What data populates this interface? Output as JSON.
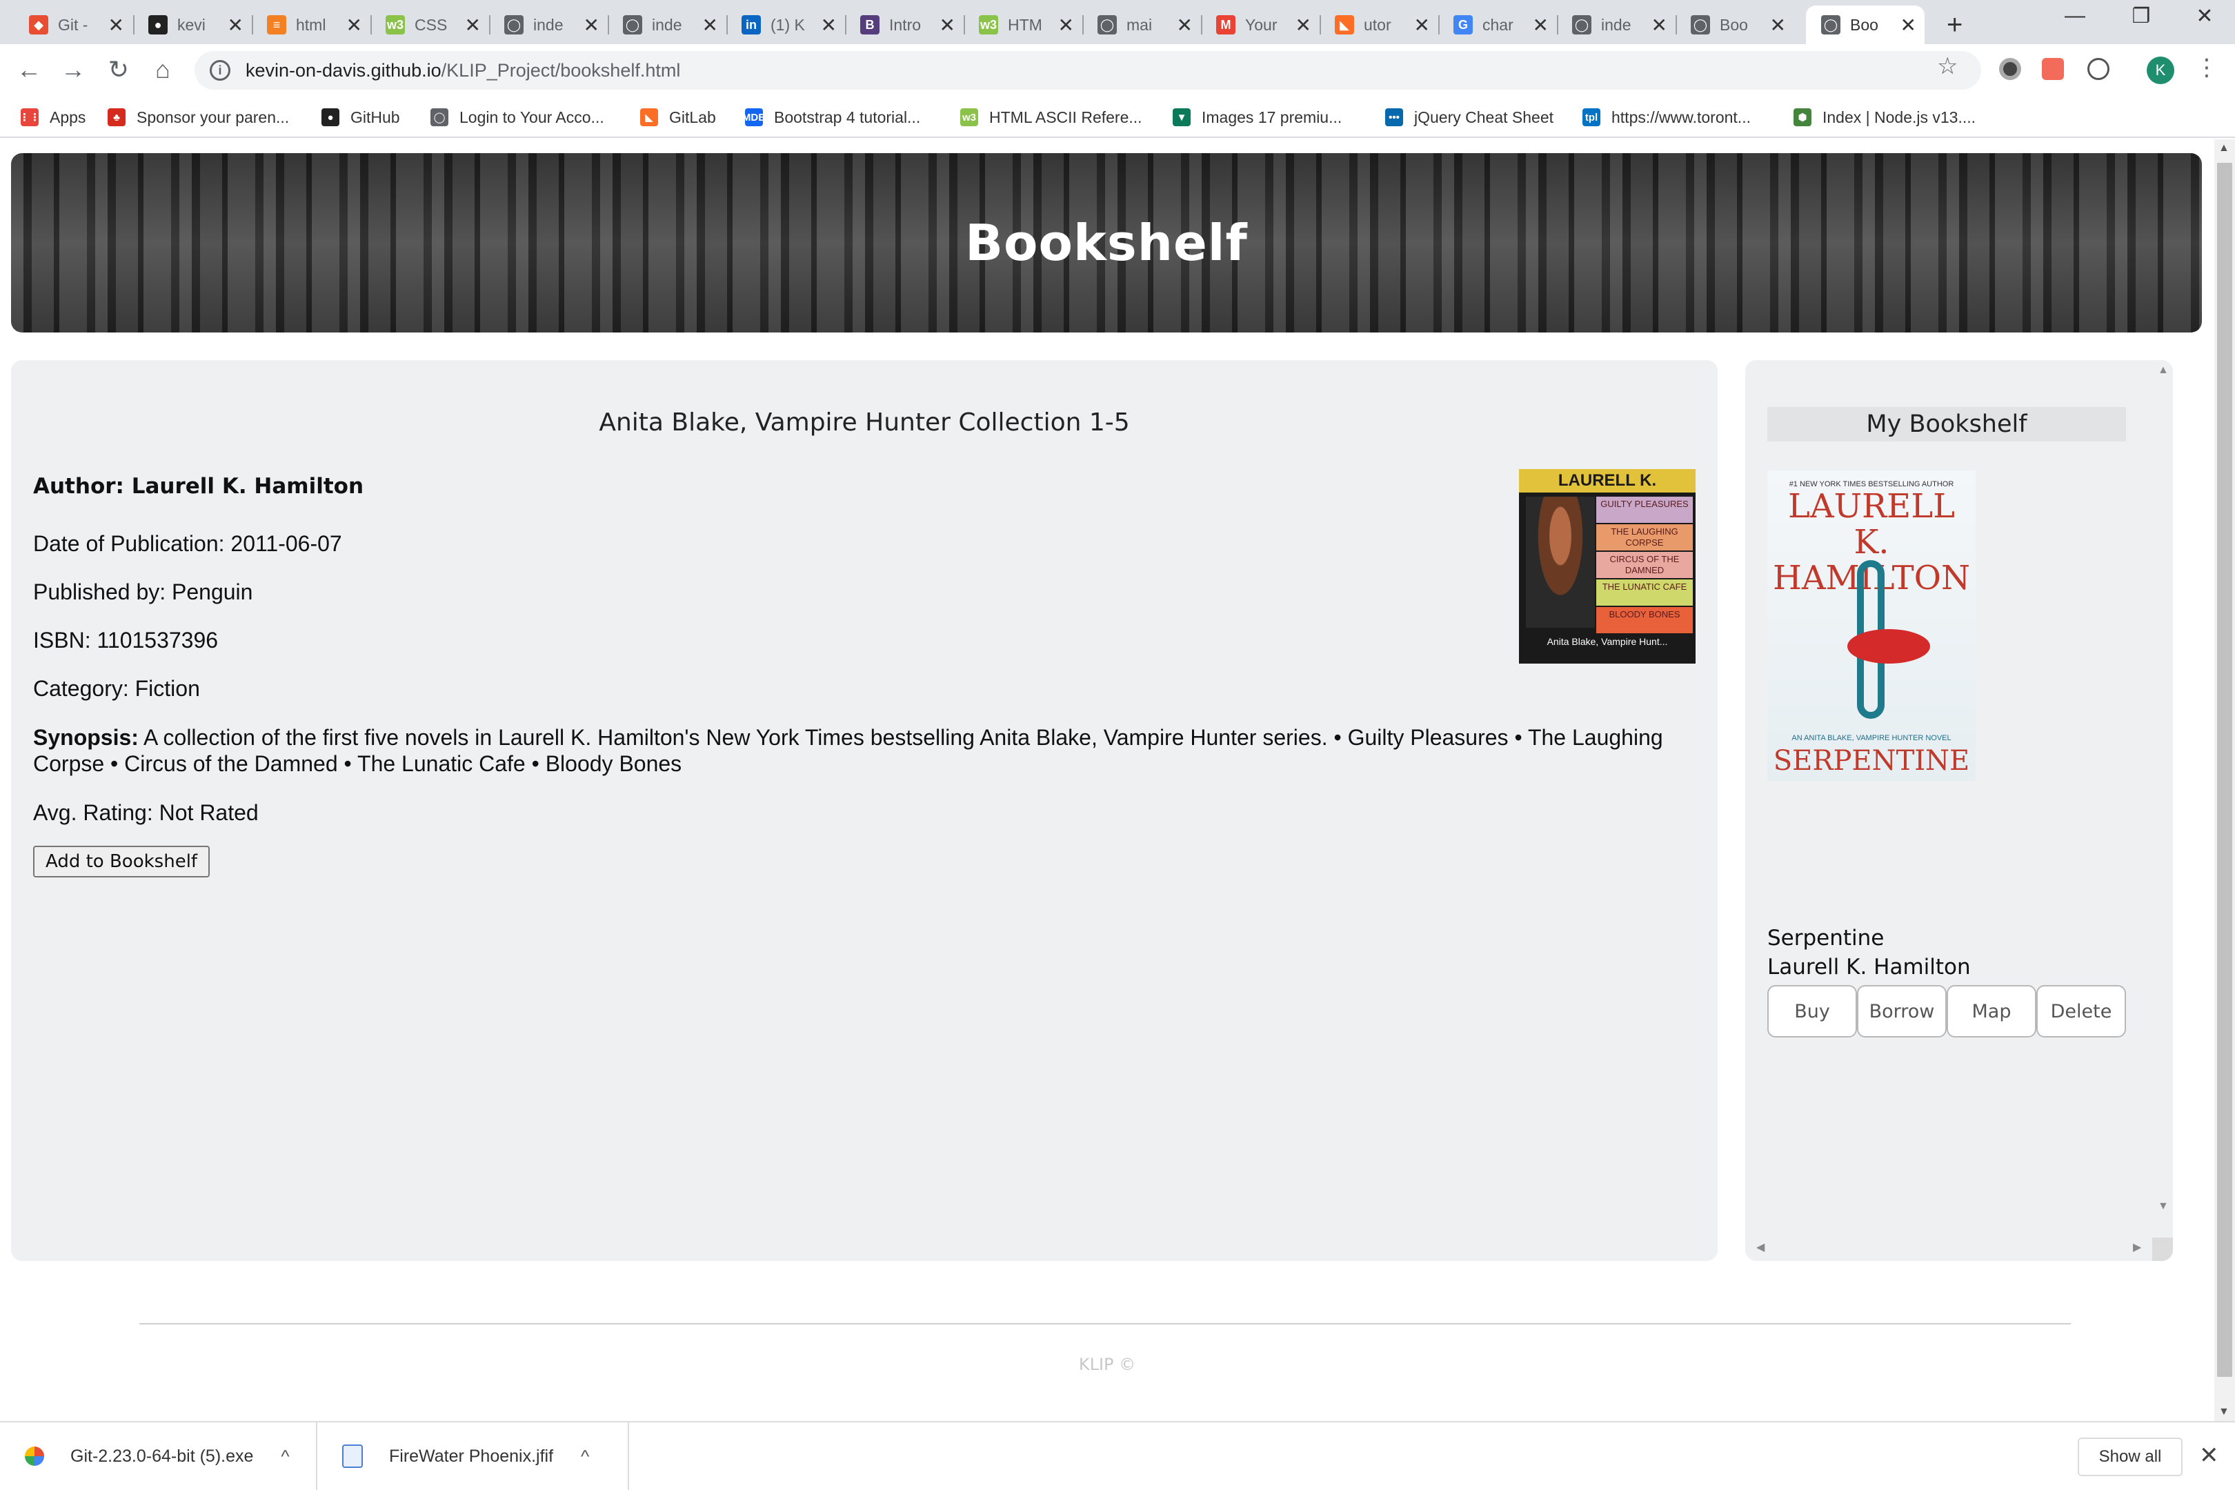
{
  "browser": {
    "tabs": [
      {
        "label": "Git -",
        "fav_color": "#e84e31",
        "fav_glyph": "◆"
      },
      {
        "label": "kevi",
        "fav_color": "#222222",
        "fav_glyph": "●"
      },
      {
        "label": "html",
        "fav_color": "#f48024",
        "fav_glyph": "≡"
      },
      {
        "label": "CSS",
        "fav_color": "#8bc34a",
        "fav_glyph": "w3"
      },
      {
        "label": "inde",
        "fav_color": "#5f6368",
        "fav_glyph": "◯"
      },
      {
        "label": "inde",
        "fav_color": "#5f6368",
        "fav_glyph": "◯"
      },
      {
        "label": "(1) K",
        "fav_color": "#0a66c2",
        "fav_glyph": "in"
      },
      {
        "label": "Intro",
        "fav_color": "#563d7c",
        "fav_glyph": "B"
      },
      {
        "label": "HTM",
        "fav_color": "#8bc34a",
        "fav_glyph": "w3"
      },
      {
        "label": "mai",
        "fav_color": "#5f6368",
        "fav_glyph": "◯"
      },
      {
        "label": "Your",
        "fav_color": "#ea4335",
        "fav_glyph": "M"
      },
      {
        "label": "utor",
        "fav_color": "#fc6d26",
        "fav_glyph": "◣"
      },
      {
        "label": "char",
        "fav_color": "#4285f4",
        "fav_glyph": "G"
      },
      {
        "label": "inde",
        "fav_color": "#5f6368",
        "fav_glyph": "◯"
      },
      {
        "label": "Boo",
        "fav_color": "#5f6368",
        "fav_glyph": "◯"
      },
      {
        "label": "Boo",
        "fav_color": "#5f6368",
        "fav_glyph": "◯"
      }
    ],
    "close_glyph": "✕",
    "new_tab_glyph": "+",
    "window_controls": [
      "—",
      "❐",
      "✕"
    ],
    "nav": {
      "back": "←",
      "forward": "→",
      "reload": "↻",
      "home": "⌂"
    },
    "url_host": "kevin-on-davis.github.io",
    "url_path": "/KLIP_Project/bookshelf.html",
    "profile_initial": "K",
    "menu_glyph": "⋮",
    "star_glyph": "☆",
    "info_glyph": "i",
    "bookmarks": [
      {
        "label": "Apps",
        "icon_color": "#e8453c",
        "glyph": "⋮⋮"
      },
      {
        "label": "Sponsor your paren...",
        "icon_color": "#d52b1e",
        "glyph": "♣"
      },
      {
        "label": "GitHub",
        "icon_color": "#222222",
        "glyph": "●"
      },
      {
        "label": "Login to Your Acco...",
        "icon_color": "#5f6368",
        "glyph": "◯"
      },
      {
        "label": "GitLab",
        "icon_color": "#fc6d26",
        "glyph": "◣"
      },
      {
        "label": "Bootstrap 4 tutorial...",
        "icon_color": "#1266f1",
        "glyph": "MDB"
      },
      {
        "label": "HTML ASCII Refere...",
        "icon_color": "#8bc34a",
        "glyph": "w3"
      },
      {
        "label": "Images 17 premiu...",
        "icon_color": "#0a7a5a",
        "glyph": "▼"
      },
      {
        "label": "jQuery Cheat Sheet",
        "icon_color": "#0769ad",
        "glyph": "•••"
      },
      {
        "label": "https://www.toront...",
        "icon_color": "#0073c5",
        "glyph": "tpl"
      },
      {
        "label": "Index | Node.js v13....",
        "icon_color": "#43853d",
        "glyph": "⬢"
      }
    ]
  },
  "page": {
    "banner_title": "Bookshelf",
    "book": {
      "title": "Anita Blake, Vampire Hunter Collection 1-5",
      "author_line": "Author: Laurell K. Hamilton",
      "date_line": "Date of Publication: 2011-06-07",
      "publisher_line": "Published by: Penguin",
      "isbn_line": "ISBN: 1101537396",
      "category_line": "Category: Fiction",
      "synopsis_label": "Synopsis:",
      "synopsis_text": " A collection of the first five novels in Laurell K. Hamilton's New York Times bestselling Anita Blake, Vampire Hunter series. • Guilty Pleasures • The Laughing Corpse • Circus of the Damned • The Lunatic Cafe • Bloody Bones",
      "rating_line": "Avg. Rating: Not Rated",
      "add_button": "Add to Bookshelf",
      "cover": {
        "band_text": "LAURELL K. HAMILTON",
        "stripes": [
          "GUILTY PLEASURES",
          "THE LAUGHING CORPSE",
          "CIRCUS OF THE DAMNED",
          "THE LUNATIC CAFE",
          "BLOODY BONES"
        ],
        "stripe_colors": [
          "#c8a7c9",
          "#e89a6b",
          "#e8a8a0",
          "#cfd86a",
          "#e8613a"
        ],
        "subtitle": "Anita Blake, Vampire Hunt..."
      }
    },
    "shelf": {
      "heading": "My Bookshelf",
      "item": {
        "cover_tagline": "#1 NEW YORK TIMES BESTSELLING AUTHOR",
        "cover_author": "LAURELL K. HAMILTON",
        "cover_series": "AN ANITA BLAKE, VAMPIRE HUNTER NOVEL",
        "cover_title": "SERPENTINE",
        "title": "Serpentine",
        "author": "Laurell K. Hamilton",
        "buttons": [
          "Buy",
          "Borrow",
          "Map",
          "Delete"
        ]
      }
    },
    "footer": "KLIP ©"
  },
  "downloads": {
    "items": [
      {
        "name": "Git-2.23.0-64-bit (5).exe"
      },
      {
        "name": "FireWater Phoenix.jfif"
      }
    ],
    "caret": "^",
    "show_all": "Show all",
    "close_glyph": "✕"
  }
}
